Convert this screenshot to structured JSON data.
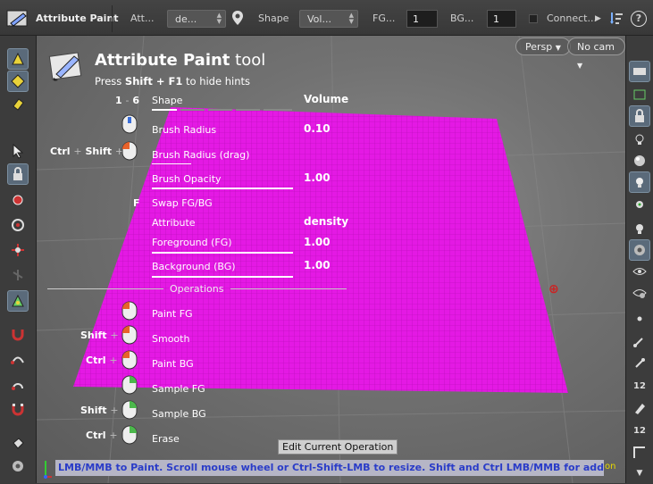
{
  "toolbar": {
    "title": "Attribute Paint",
    "attr_label": "Att...",
    "attr_value": "de...",
    "shape_label": "Shape",
    "shape_value": "Vol...",
    "fg_label": "FG...",
    "fg_value": "1",
    "bg_label": "BG...",
    "bg_value": "1",
    "connect_label": "Connect...",
    "help": "?"
  },
  "viewport": {
    "persp_label": "Persp",
    "cam_label": "No cam"
  },
  "hud": {
    "title_bold": "Attribute Paint",
    "title_light": " tool",
    "sub_pre": "Press ",
    "sub_key": "Shift + F1",
    "sub_post": " to hide hints",
    "shape_key_a": "1",
    "shape_key_sep": "-",
    "shape_key_b": "6",
    "shape_label": "Shape",
    "shape_value": "Volume",
    "radius_label": "Brush Radius",
    "radius_value": "0.10",
    "radius_drag_label": "Brush Radius (drag)",
    "ctrl": "Ctrl",
    "shift": "Shift",
    "plus": "+",
    "opacity_label": "Brush Opacity",
    "opacity_value": "1.00",
    "swap_key": "F",
    "swap_label": "Swap FG/BG",
    "attribute_label": "Attribute",
    "attribute_value": "density",
    "fg_label": "Foreground (FG)",
    "fg_value": "1.00",
    "bg_label": "Background (BG)",
    "bg_value": "1.00",
    "operations_label": "Operations",
    "op_paint_fg": "Paint FG",
    "op_smooth": "Smooth",
    "op_paint_bg": "Paint BG",
    "op_sample_fg": "Sample FG",
    "op_sample_bg": "Sample BG",
    "op_erase": "Erase"
  },
  "tooltip": "Edit Current Operation",
  "footer": {
    "message": "LMB/MMB to Paint.  Scroll mouse wheel or Ctrl-Shift-LMB to resize.  Shift and Ctrl LMB/MMB for additional operations.",
    "suffix": "on"
  },
  "colors": {
    "paint": "#e419e4",
    "accent": "#2a3cc8"
  }
}
